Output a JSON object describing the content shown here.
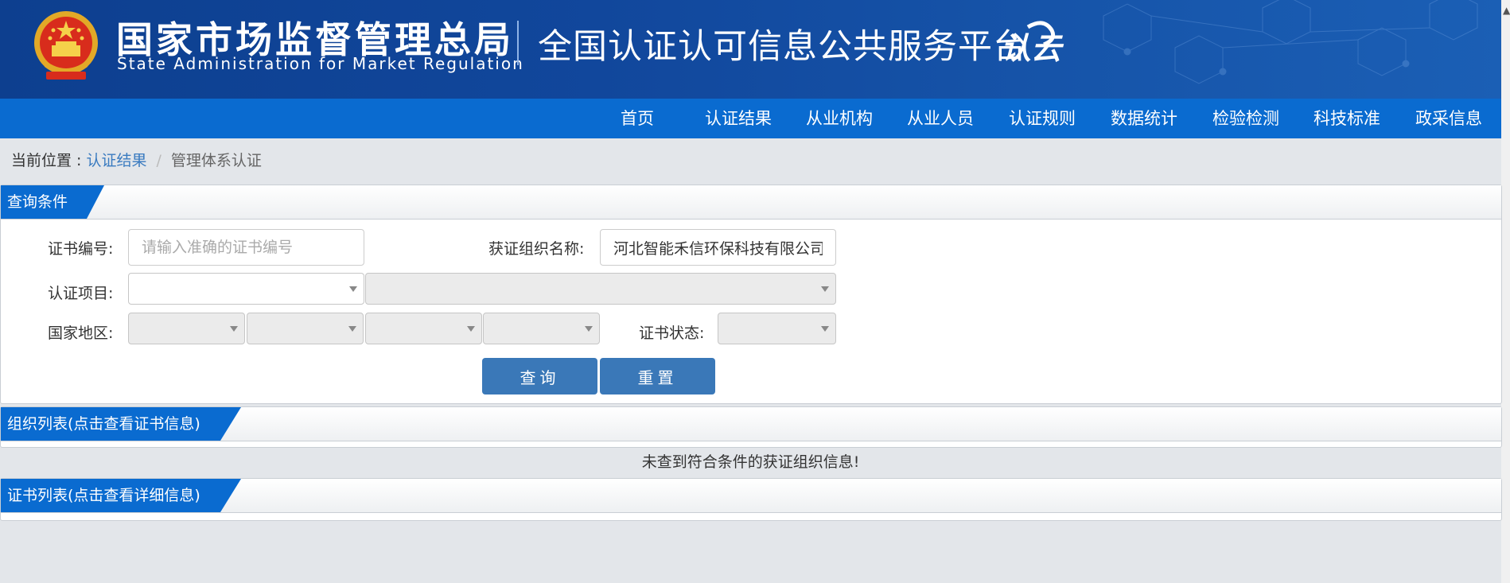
{
  "header": {
    "agency_name_cn": "国家市场监督管理总局",
    "agency_name_en": "State Administration  for  Market Regulation",
    "platform_title": "全国认证认可信息公共服务平台",
    "cloud_logo_text": "认云"
  },
  "nav": {
    "items": [
      "首页",
      "认证结果",
      "从业机构",
      "从业人员",
      "认证规则",
      "数据统计",
      "检验检测",
      "科技标准",
      "政采信息"
    ]
  },
  "breadcrumb": {
    "prefix": "当前位置 : ",
    "link": "认证结果",
    "separator": "/",
    "current": "管理体系认证"
  },
  "query_panel": {
    "title": "查询条件",
    "cert_number": {
      "label": "证书编号:",
      "placeholder": "请输入准确的证书编号",
      "value": ""
    },
    "org_name": {
      "label": "获证组织名称:",
      "value": "河北智能禾信环保科技有限公司"
    },
    "cert_project": {
      "label": "认证项目:"
    },
    "region": {
      "label": "国家地区:"
    },
    "cert_status": {
      "label": "证书状态:"
    },
    "search_button": "查询",
    "reset_button": "重置"
  },
  "org_list": {
    "title": "组织列表(点击查看证书信息)",
    "empty_message": "未查到符合条件的获证组织信息!"
  },
  "cert_list": {
    "title": "证书列表(点击查看详细信息)"
  },
  "colors": {
    "header_blue": "#11479c",
    "nav_blue": "#0a6bd0",
    "tab_blue": "#0a6bd0",
    "button_blue": "#3a78b8",
    "link_blue": "#3a7bc0"
  }
}
